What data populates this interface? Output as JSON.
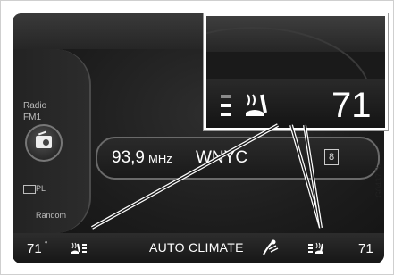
{
  "source": {
    "title": "Radio",
    "band": "FM1",
    "rds_label": "PL",
    "random_label": "Random"
  },
  "station": {
    "frequency": "93,9",
    "unit": "MHz",
    "name": "WNYC",
    "preset_marker": "8"
  },
  "climate": {
    "left_temp": "71",
    "left_deg": "°",
    "mode_label": "AUTO CLIMATE",
    "right_temp_partial": "71"
  },
  "zoom": {
    "temp": "71"
  },
  "image_code": "G043776",
  "icons": {
    "radio": "radio-icon",
    "rds": "rds-icon",
    "seat_heater_left": "seat-heater-icon",
    "seat_heater_right": "seat-heater-icon",
    "fan": "fan-icon"
  }
}
